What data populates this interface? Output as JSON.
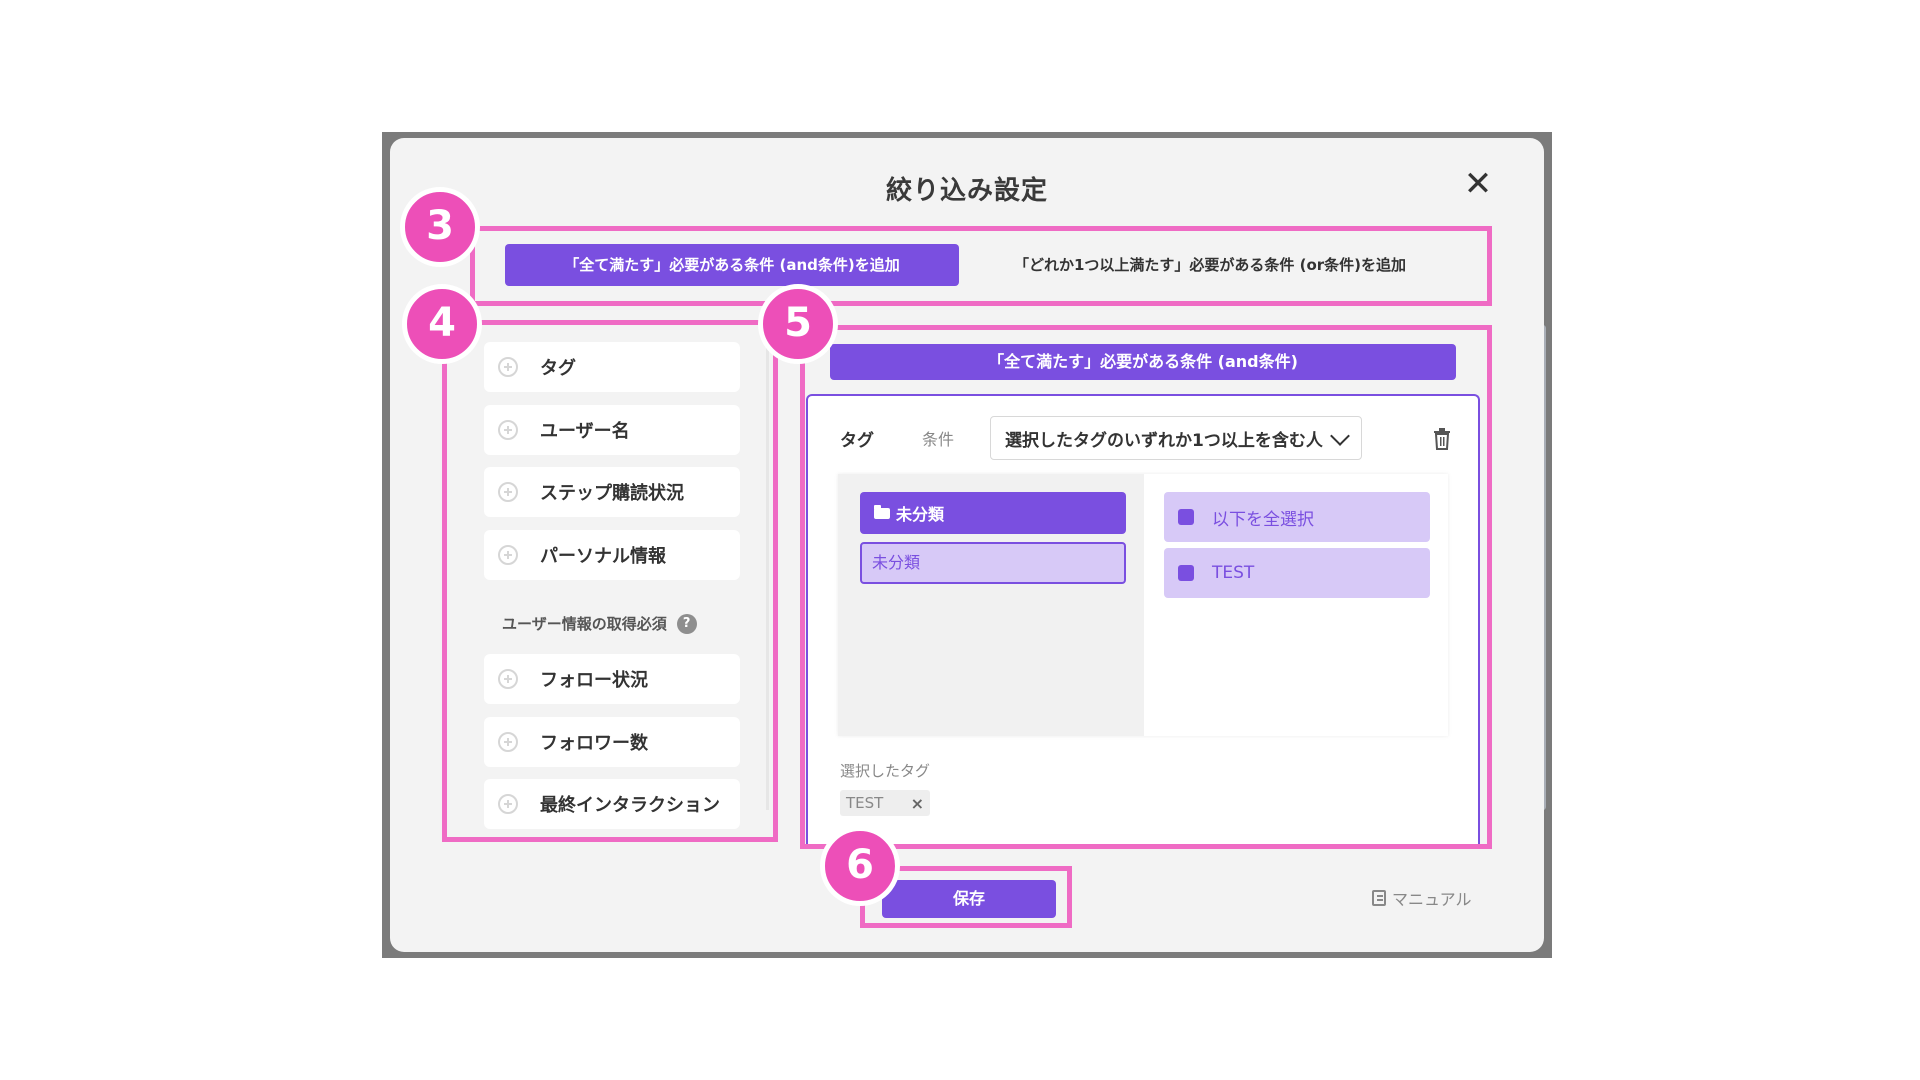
{
  "modal": {
    "title": "絞り込み設定",
    "close_glyph": "✕"
  },
  "tabs": {
    "and_label": "「全て満たす」必要がある条件 (and条件)を追加",
    "or_label": "「どれか1つ以上満たす」必要がある条件 (or条件)を追加"
  },
  "conditions": {
    "basic": [
      "タグ",
      "ユーザー名",
      "ステップ購読状況",
      "パーソナル情報"
    ],
    "section_title": "ユーザー情報の取得必須",
    "help_glyph": "?",
    "extended": [
      "フォロー状況",
      "フォロワー数",
      "最終インタラクション"
    ]
  },
  "and_panel": {
    "header": "「全て満たす」必要がある条件 (and条件)",
    "tag_label": "タグ",
    "cond_label": "条件",
    "select_value": "選択したタグのいずれか1つ以上を含む人",
    "folder_active": "未分類",
    "folder_sub": "未分類",
    "tag_options": [
      "以下を全選択",
      "TEST"
    ],
    "selected_label": "選択したタグ",
    "selected_chip": "TEST",
    "chip_close": "×"
  },
  "footer": {
    "save_label": "保存",
    "manual_label": "マニュアル"
  },
  "annotations": [
    "3",
    "4",
    "5",
    "6"
  ],
  "colors": {
    "accent": "#7a4fe0",
    "accent_light": "#d7c9f7",
    "highlight": "#ef6bc4",
    "badge": "#ed4fb8"
  },
  "icons": [
    "close-icon",
    "plus-circle-icon",
    "help-icon",
    "chevron-down-icon",
    "trash-icon",
    "folder-icon",
    "book-icon"
  ]
}
